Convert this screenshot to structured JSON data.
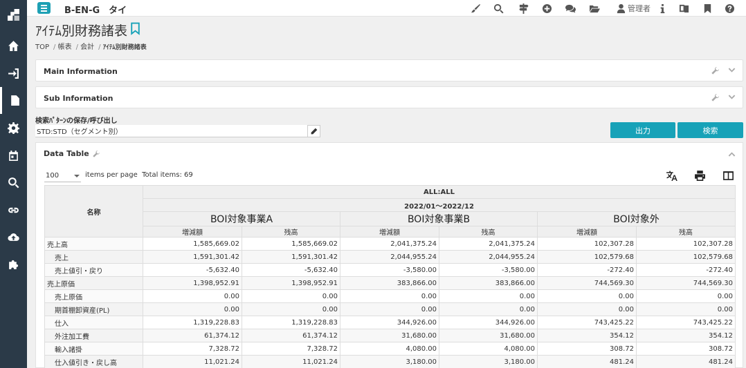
{
  "app": {
    "title": "B-EN-G　タイ"
  },
  "toolbar": {
    "user_label": "管理者"
  },
  "page": {
    "title": "ｱｲﾃﾑ別財務諸表",
    "breadcrumb": [
      "TOP",
      "帳表",
      "会計",
      "ｱｲﾃﾑ別財務諸表"
    ]
  },
  "panels": {
    "main_info": "Main Information",
    "sub_info": "Sub Information"
  },
  "search_pattern": {
    "label": "検索ﾊﾟﾀｰﾝの保存/呼び出し",
    "value": "STD:STD（セグメント別）",
    "output_button": "出力",
    "search_button": "検索"
  },
  "data_table": {
    "title": "Data Table",
    "per_page": "100",
    "items_label": "items per page",
    "total_label": "Total items: 69",
    "header": {
      "name_col": "名称",
      "group": "ALL:ALL",
      "period": "2022/01～2022/12",
      "segments": [
        "BOI対象事業A",
        "BOI対象事業B",
        "BOI対象外"
      ],
      "sub_cols": [
        "増減額",
        "残高"
      ]
    },
    "rows": [
      {
        "name": "売上高",
        "indent": false,
        "v": [
          "1,585,669.02",
          "1,585,669.02",
          "2,041,375.24",
          "2,041,375.24",
          "102,307.28",
          "102,307.28"
        ]
      },
      {
        "name": "売上",
        "indent": true,
        "v": [
          "1,591,301.42",
          "1,591,301.42",
          "2,044,955.24",
          "2,044,955.24",
          "102,579.68",
          "102,579.68"
        ]
      },
      {
        "name": "売上値引・戻り",
        "indent": true,
        "v": [
          "-5,632.40",
          "-5,632.40",
          "-3,580.00",
          "-3,580.00",
          "-272.40",
          "-272.40"
        ]
      },
      {
        "name": "売上原価",
        "indent": false,
        "v": [
          "1,398,952.91",
          "1,398,952.91",
          "383,866.00",
          "383,866.00",
          "744,569.30",
          "744,569.30"
        ]
      },
      {
        "name": "売上原価",
        "indent": true,
        "v": [
          "0.00",
          "0.00",
          "0.00",
          "0.00",
          "0.00",
          "0.00"
        ]
      },
      {
        "name": "期首棚卸資産(PL)",
        "indent": true,
        "v": [
          "0.00",
          "0.00",
          "0.00",
          "0.00",
          "0.00",
          "0.00"
        ]
      },
      {
        "name": "仕入",
        "indent": true,
        "v": [
          "1,319,228.83",
          "1,319,228.83",
          "344,926.00",
          "344,926.00",
          "743,425.22",
          "743,425.22"
        ]
      },
      {
        "name": "外注加工費",
        "indent": true,
        "v": [
          "61,374.12",
          "61,374.12",
          "31,680.00",
          "31,680.00",
          "354.12",
          "354.12"
        ]
      },
      {
        "name": "輸入諸掛",
        "indent": true,
        "v": [
          "7,328.72",
          "7,328.72",
          "4,080.00",
          "4,080.00",
          "308.72",
          "308.72"
        ]
      },
      {
        "name": "仕入値引き・戻し高",
        "indent": true,
        "v": [
          "11,021.24",
          "11,021.24",
          "3,180.00",
          "3,180.00",
          "481.24",
          "481.24"
        ]
      }
    ]
  },
  "colors": {
    "accent": "#17a2b8",
    "sidebar": "#2b3a48"
  }
}
